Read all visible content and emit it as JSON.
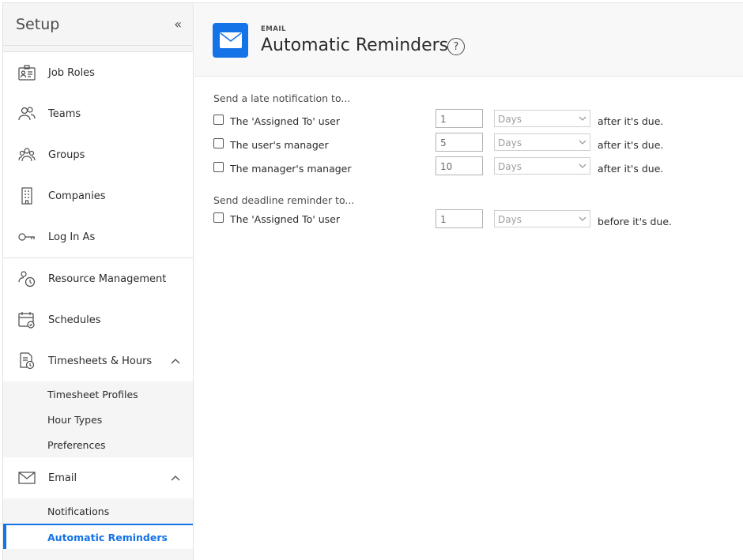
{
  "sidebar": {
    "title": "Setup",
    "collapse_glyph": "«",
    "items": [
      {
        "label": "Job Roles",
        "icon": "job-roles-icon"
      },
      {
        "label": "Teams",
        "icon": "teams-icon"
      },
      {
        "label": "Groups",
        "icon": "groups-icon"
      },
      {
        "label": "Companies",
        "icon": "companies-icon"
      },
      {
        "label": "Log In As",
        "icon": "key-icon"
      },
      {
        "label": "Resource Management",
        "icon": "resource-management-icon"
      },
      {
        "label": "Schedules",
        "icon": "calendar-icon"
      },
      {
        "label": "Timesheets & Hours",
        "icon": "timesheet-icon"
      },
      {
        "label": "Email",
        "icon": "envelope-icon"
      }
    ],
    "timesheets_sub": [
      "Timesheet Profiles",
      "Hour Types",
      "Preferences"
    ],
    "email_sub": [
      "Notifications",
      "Automatic Reminders"
    ]
  },
  "header": {
    "eyebrow": "EMAIL",
    "title": "Automatic Reminders",
    "help_glyph": "?"
  },
  "late": {
    "heading": "Send a late notification to...",
    "rows": [
      {
        "label": "The 'Assigned To' user",
        "value": "1",
        "unit": "Days",
        "suffix": "after it's due."
      },
      {
        "label": "The user's manager",
        "value": "5",
        "unit": "Days",
        "suffix": "after it's due."
      },
      {
        "label": "The manager's manager",
        "value": "10",
        "unit": "Days",
        "suffix": "after it's due."
      }
    ]
  },
  "deadline": {
    "heading": "Send deadline reminder to...",
    "rows": [
      {
        "label": "The 'Assigned To' user",
        "value": "1",
        "unit": "Days",
        "suffix": "before it's due."
      }
    ]
  },
  "colors": {
    "accent": "#1473e6",
    "sidebar_bg": "#f5f5f5"
  }
}
